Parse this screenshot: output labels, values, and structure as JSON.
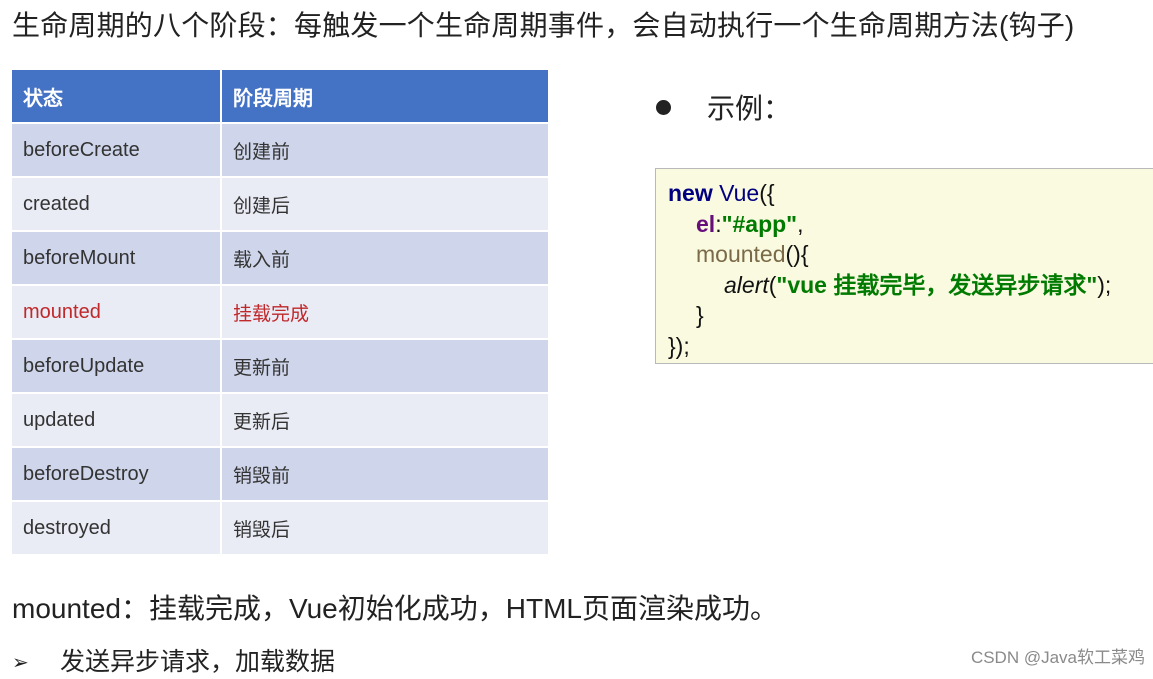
{
  "page": {
    "title": "生命周期的八个阶段：每触发一个生命周期事件，会自动执行一个生命周期方法(钩子)"
  },
  "table": {
    "headers": [
      "状态",
      "阶段周期"
    ],
    "rows": [
      {
        "state": "beforeCreate",
        "phase": "创建前"
      },
      {
        "state": "created",
        "phase": "创建后"
      },
      {
        "state": "beforeMount",
        "phase": "载入前"
      },
      {
        "state": "mounted",
        "phase": "挂载完成"
      },
      {
        "state": "beforeUpdate",
        "phase": "更新前"
      },
      {
        "state": "updated",
        "phase": "更新后"
      },
      {
        "state": "beforeDestroy",
        "phase": "销毁前"
      },
      {
        "state": "destroyed",
        "phase": "销毁后"
      }
    ],
    "highlight_row": "mounted",
    "colors": {
      "header": "#4472c4",
      "row_dark": "#cfd5ea",
      "row_light": "#e9ebf5",
      "highlight_text": "#c0282a"
    }
  },
  "example": {
    "label": "示例：",
    "bullet_icon": "filled-circle-icon",
    "code": {
      "line1": {
        "kw": "new",
        "cls": "Vue",
        "rest": "({"
      },
      "line2": {
        "prop": "el",
        "colon": ":",
        "value": "\"#app\"",
        "rest": ","
      },
      "line3": {
        "method": "mounted",
        "rest": "(){"
      },
      "line4": {
        "fn": "alert",
        "open": "(",
        "value": "\"vue 挂载完毕，发送异步请求\"",
        "rest": ");"
      },
      "line5": {
        "text": "}"
      },
      "line6": {
        "text": "});"
      }
    },
    "colors": {
      "background": "#fafae0",
      "keyword": "#000080",
      "property": "#660e7a",
      "string": "#007a00",
      "method": "#7a6a48"
    }
  },
  "summary": {
    "text": "mounted：挂载完成，Vue初始化成功，HTML页面渲染成功。"
  },
  "sub_bullet": {
    "icon": "arrow-bullet-icon",
    "arrow": "➢",
    "text": "发送异步请求，加载数据"
  },
  "watermark": {
    "text": "CSDN @Java软工菜鸡"
  }
}
